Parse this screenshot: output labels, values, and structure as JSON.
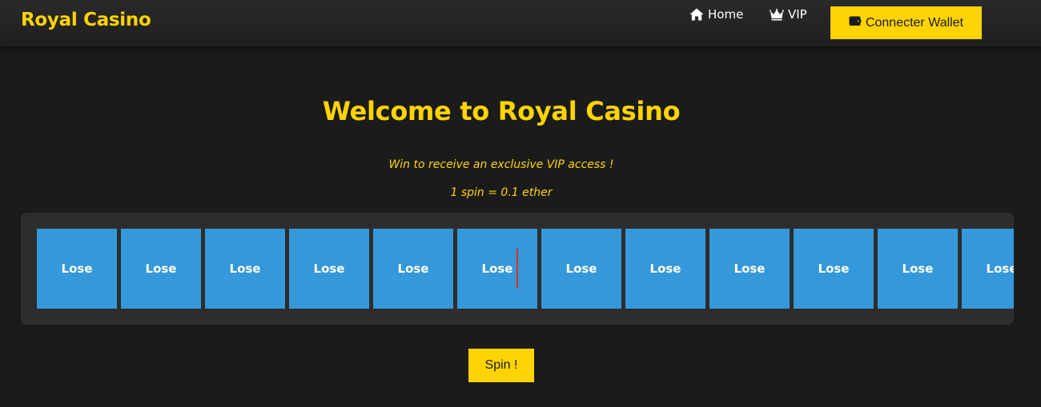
{
  "colors": {
    "background": "#1b1b1b",
    "accent": "#ffd400",
    "reel_cell": "#3498db",
    "reel_panel": "#2d2d2d",
    "pointer": "#e0302a"
  },
  "navbar": {
    "brand": "Royal Casino",
    "links": [
      {
        "label": "Home",
        "icon": "home-icon"
      },
      {
        "label": "VIP",
        "icon": "crown-icon"
      }
    ],
    "wallet_button": {
      "label": "Connecter Wallet",
      "icon": "wallet-icon"
    }
  },
  "main": {
    "title": "Welcome to Royal Casino",
    "subtitle": "Win to receive an exclusive VIP access !",
    "price_note": "1 spin = 0.1 ether",
    "reel": [
      "Lose",
      "Lose",
      "Lose",
      "Lose",
      "Lose",
      "Lose",
      "Lose",
      "Lose",
      "Lose",
      "Lose",
      "Lose",
      "Lose"
    ],
    "spin_button": "Spin !"
  }
}
